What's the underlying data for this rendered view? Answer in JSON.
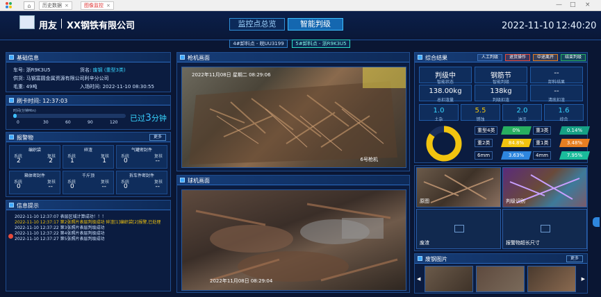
{
  "browser": {
    "tabs": [
      {
        "label": "历史数据"
      },
      {
        "label": "图像监控"
      }
    ],
    "close": "×",
    "window_controls": [
      "—",
      "□",
      "×"
    ]
  },
  "header": {
    "brand": "用友",
    "company": "XX钢铁有限公司",
    "nav_tabs": [
      {
        "label": "监控点总览"
      },
      {
        "label": "智能判级"
      }
    ],
    "date": "2022-11-10",
    "time": "12:40:20",
    "points": [
      {
        "label": "4#卸料点 - 皖UU3199"
      },
      {
        "label": "5#卸料点 - 浙R9K3U5"
      }
    ]
  },
  "basic": {
    "title": "基础信息",
    "plate_label": "车号:",
    "plate": "浙R9K3U5",
    "cargo_label": "货名:",
    "cargo": "废钢 (重型3类)",
    "supplier_label": "供货:",
    "supplier": "马钢富圆金属资源有限公司利辛分公司",
    "gross_label": "毛重:",
    "gross": "49吨",
    "entry_label": "入场时间:",
    "entry": "2022-11-10 08:30:55"
  },
  "swipe": {
    "title": "刷卡时间:",
    "time": "12:37:03",
    "scale_label": "时间(分钟Min)",
    "ticks": [
      "0",
      "30",
      "60",
      "90",
      "120"
    ],
    "progress": 0.03,
    "passed_prefix": "已过",
    "passed_num": "3",
    "passed_suffix": "分钟"
  },
  "alarms": {
    "title": "报警物",
    "more": "更多",
    "items": [
      {
        "name": "编织袋",
        "k1": "系统",
        "k2": "复核",
        "v1": "2",
        "v2": "2"
      },
      {
        "name": "碎渣",
        "k1": "系统",
        "k2": "复核",
        "v1": "1",
        "v2": "1"
      },
      {
        "name": "气罐密封件",
        "k1": "系统",
        "k2": "复核",
        "v1": "0",
        "v2": "--"
      },
      {
        "name": "箱体密封件",
        "k1": "系统",
        "k2": "复核",
        "v1": "0",
        "v2": "--"
      },
      {
        "name": "千斤顶",
        "k1": "系统",
        "k2": "复核",
        "v1": "0",
        "v2": "--"
      },
      {
        "name": "拆车件密封件",
        "k1": "系统",
        "k2": "复核",
        "v1": "0",
        "v2": "--"
      }
    ]
  },
  "messages": {
    "title": "信息提示",
    "items": [
      {
        "text": "2022-11-10 12:37:07 表层区域计算成功！！！"
      },
      {
        "text": "2022-11-10 12:37:17 第2张照片表层判级成功 碎渣[1]编织袋[2]报警,已处理"
      },
      {
        "text": "2022-11-10 12:37:22 第3张照片表层判级成功"
      },
      {
        "text": "2022-11-10 12:37:22 第4张照片表层判级成功"
      },
      {
        "text": "2022-11-10 12:37:27 第5张照片表层判级成功"
      }
    ]
  },
  "cameras": {
    "gun_title": "枪机画面",
    "gun_osd": "2022年11月08日 星期二 08:29:06",
    "gun_label": "6号枪机",
    "dome_title": "球机画面",
    "dome_osd": "2022年11月08日 08:29:04"
  },
  "results": {
    "title": "综合结果",
    "buttons": [
      {
        "label": "人工判级"
      },
      {
        "label": "退货操作"
      },
      {
        "label": "中途离开"
      },
      {
        "label": "结束判级"
      }
    ],
    "button_colors": [
      "#3a6fb8",
      "#e74c3c",
      "#e67e22",
      "#27ae60"
    ],
    "stats": [
      {
        "v": "判级中",
        "k": "智能状态"
      },
      {
        "v": "钢筋节",
        "k": "智能判级"
      },
      {
        "v": "--",
        "k": "卸料结果"
      },
      {
        "v": "138.00kg",
        "k": "总扣渣量"
      },
      {
        "v": "138kg",
        "k": "判级扣渣"
      },
      {
        "v": "--",
        "k": "清底扣渣"
      }
    ],
    "small": [
      {
        "v": "1.0",
        "k": "土杂"
      },
      {
        "v": "5.5",
        "k": "锈蚀"
      },
      {
        "v": "2.0",
        "k": "油污"
      },
      {
        "v": "1.6",
        "k": "综合"
      }
    ],
    "donut_share": 0.848,
    "donut_colors": [
      "#f1c40f",
      "#1a2f5c"
    ],
    "grades": [
      {
        "name": "重型4类",
        "pct": "0%",
        "color": "#27ae60"
      },
      {
        "name": "重3类",
        "pct": "0.14%",
        "color": "#16a085"
      },
      {
        "name": "重2类",
        "pct": "84.8%",
        "color": "#f1c40f"
      },
      {
        "name": "重1类",
        "pct": "3.48%",
        "color": "#e67e22"
      },
      {
        "name": "6mm",
        "pct": "3.63%",
        "color": "#2e86de"
      },
      {
        "name": "4mm",
        "pct": "7.95%",
        "color": "#1abc9c"
      }
    ]
  },
  "views": {
    "original": "原图",
    "recognize": "判级识别",
    "slag": "废渣",
    "oversize": "报警物超长尺寸"
  },
  "gallery": {
    "title": "废钢图片",
    "more": "更多",
    "prev": "◀",
    "next": "▶"
  }
}
